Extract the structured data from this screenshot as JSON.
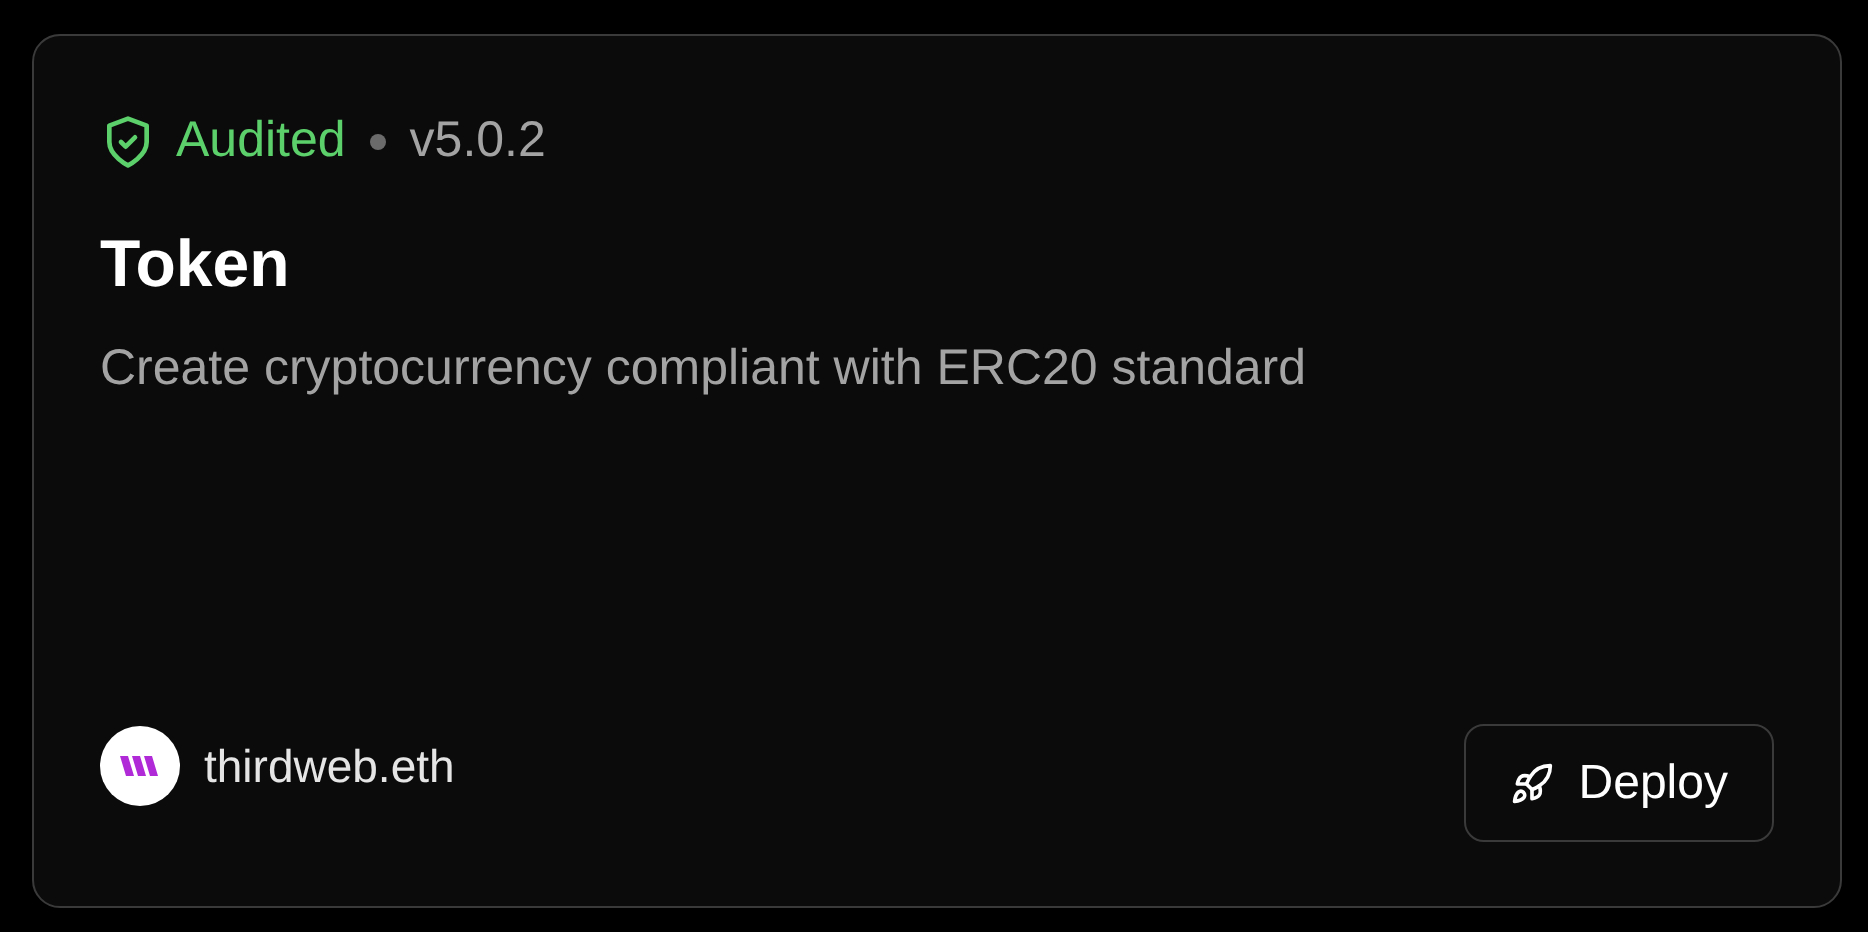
{
  "card": {
    "status": "Audited",
    "version": "v5.0.2",
    "title": "Token",
    "description": "Create cryptocurrency compliant with ERC20 standard",
    "publisher": "thirdweb.eth",
    "action": "Deploy"
  }
}
